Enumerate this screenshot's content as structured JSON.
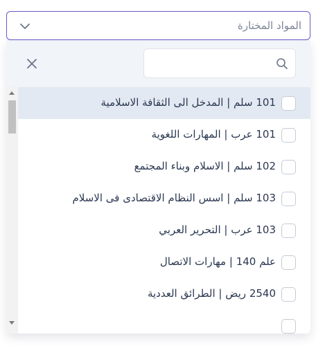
{
  "select": {
    "placeholder": "المواد المختارة",
    "chevron_icon": "chevron-down-icon"
  },
  "search": {
    "value": "",
    "placeholder": "",
    "icon": "search-icon",
    "clear_icon": "close-icon"
  },
  "options": [
    {
      "label": "101 سلم | المدخل الى الثقافة الاسلامية",
      "checked": false,
      "highlighted": true
    },
    {
      "label": "101 عرب | المهارات اللغوية",
      "checked": false,
      "highlighted": false
    },
    {
      "label": "102 سلم | الاسلام وبناء المجتمع",
      "checked": false,
      "highlighted": false
    },
    {
      "label": "103 سلم | اسس النظام الاقتصادى فى الاسلام",
      "checked": false,
      "highlighted": false
    },
    {
      "label": "103 عرب | التحرير العربي",
      "checked": false,
      "highlighted": false
    },
    {
      "label": "علم 140 | مهارات الاتصال",
      "checked": false,
      "highlighted": false
    },
    {
      "label": "2540 ريض | الطرائق العددية",
      "checked": false,
      "highlighted": false
    },
    {
      "label": "",
      "checked": false,
      "highlighted": false
    }
  ],
  "colors": {
    "accent_border": "#6a57c9",
    "highlight_row": "#e3e9f2",
    "search_area": "#f1f4f8",
    "text": "#2a3852"
  }
}
